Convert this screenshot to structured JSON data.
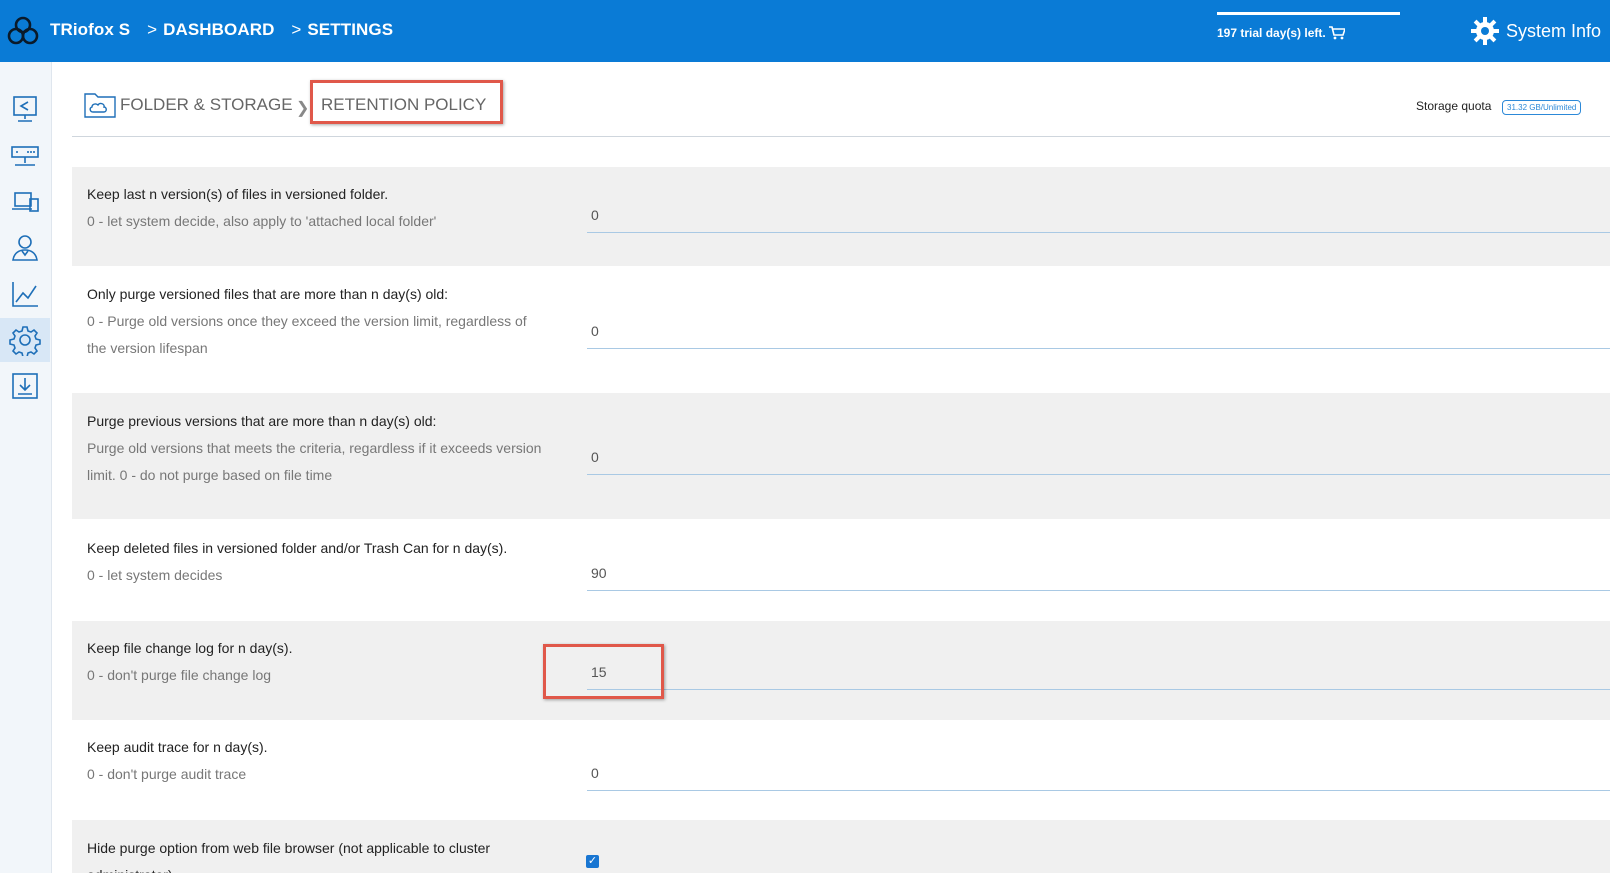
{
  "header": {
    "app_name": "TRiofox S",
    "crumb_dashboard": "DASHBOARD",
    "crumb_settings": "SETTINGS",
    "crumb_separator": ">",
    "trial_text": "197 trial day(s) left.",
    "system_info_label": "System Info",
    "accent_color": "#0a7bd6"
  },
  "sidebar": {
    "items": [
      {
        "icon": "share-screen-icon"
      },
      {
        "icon": "server-icon"
      },
      {
        "icon": "devices-icon"
      },
      {
        "icon": "users-icon"
      },
      {
        "icon": "chart-icon"
      },
      {
        "icon": "settings-icon",
        "active": true
      },
      {
        "icon": "download-icon"
      }
    ]
  },
  "breadcrumb": {
    "folder_storage": "FOLDER & STORAGE",
    "retention_policy": "RETENTION POLICY"
  },
  "quota": {
    "label": "Storage quota",
    "value": "31.32 GB/Unlimited"
  },
  "settings": [
    {
      "title": "Keep last n version(s) of files in versioned folder.",
      "hint": "0 - let system decide, also apply to 'attached local folder'",
      "value": "0"
    },
    {
      "title": "Only purge versioned files that are more than n day(s) old:",
      "hint": "0 - Purge old versions once they exceed the version limit, regardless of the version lifespan",
      "value": "0"
    },
    {
      "title": "Purge previous versions that are more than n day(s) old:",
      "hint": "Purge old versions that meets the criteria, regardless if it exceeds version limit. 0 - do not purge based on file time",
      "value": "0"
    },
    {
      "title": "Keep deleted files in versioned folder and/or Trash Can for n day(s).",
      "hint": "0 - let system decides",
      "value": "90"
    },
    {
      "title": "Keep file change log for n day(s).",
      "hint": "0 - don't purge file change log",
      "value": "15"
    },
    {
      "title": "Keep audit trace for n day(s).",
      "hint": "0 - don't purge audit trace",
      "value": "0"
    },
    {
      "title": "Hide purge option from web file browser (not applicable to cluster administrator)",
      "checked": true
    }
  ]
}
